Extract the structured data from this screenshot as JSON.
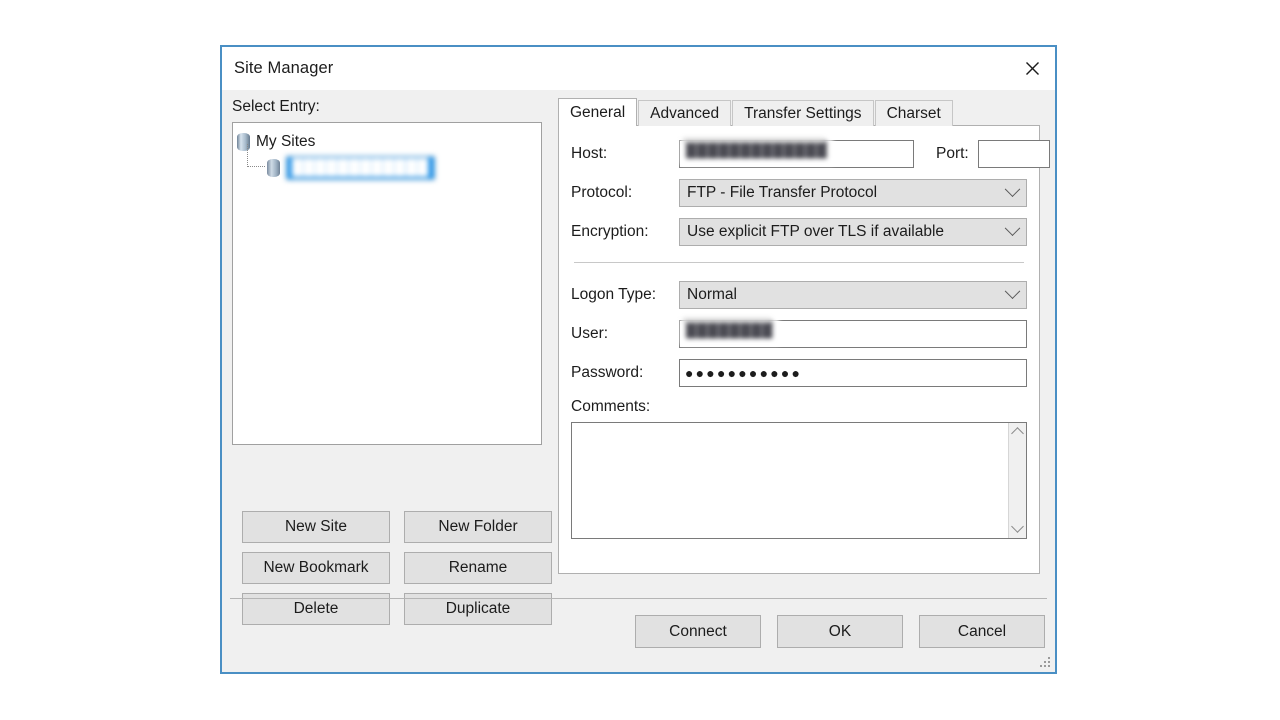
{
  "window": {
    "title": "Site Manager",
    "close_icon": "close-icon",
    "resize_grip_icon": "resize-grip-icon",
    "border_color": "#4a8fc4"
  },
  "left": {
    "select_entry_label": "Select Entry:",
    "tree": {
      "root": {
        "label": "My Sites",
        "icon": "server-icon",
        "expanded": true
      },
      "children": [
        {
          "label": "████████████",
          "icon": "server-icon",
          "selected": true,
          "redacted": true
        }
      ],
      "selection_color": "#1e90e8"
    },
    "buttons": [
      {
        "label": "New Site",
        "name": "new-site-button"
      },
      {
        "label": "New Folder",
        "name": "new-folder-button"
      },
      {
        "label": "New Bookmark",
        "name": "new-bookmark-button"
      },
      {
        "label": "Rename",
        "name": "rename-button"
      },
      {
        "label": "Delete",
        "name": "delete-button"
      },
      {
        "label": "Duplicate",
        "name": "duplicate-button"
      }
    ]
  },
  "right": {
    "tabs": [
      {
        "label": "General",
        "active": true
      },
      {
        "label": "Advanced",
        "active": false
      },
      {
        "label": "Transfer Settings",
        "active": false
      },
      {
        "label": "Charset",
        "active": false
      }
    ],
    "general": {
      "host_label": "Host:",
      "host_value": "█████████████",
      "host_redacted": true,
      "port_label": "Port:",
      "port_value": "",
      "protocol_label": "Protocol:",
      "protocol_value": "FTP - File Transfer Protocol",
      "encryption_label": "Encryption:",
      "encryption_value": "Use explicit FTP over TLS if available",
      "logon_type_label": "Logon Type:",
      "logon_type_value": "Normal",
      "user_label": "User:",
      "user_value": "████████",
      "user_redacted": true,
      "password_label": "Password:",
      "password_value": "●●●●●●●●●●●",
      "comments_label": "Comments:",
      "comments_value": "",
      "dropdown_icon": "chevron-down-icon",
      "scroll_up_icon": "chevron-up-icon",
      "scroll_down_icon": "chevron-down-icon"
    }
  },
  "footer": {
    "buttons": [
      {
        "label": "Connect",
        "name": "connect-button"
      },
      {
        "label": "OK",
        "name": "ok-button"
      },
      {
        "label": "Cancel",
        "name": "cancel-button"
      }
    ]
  }
}
